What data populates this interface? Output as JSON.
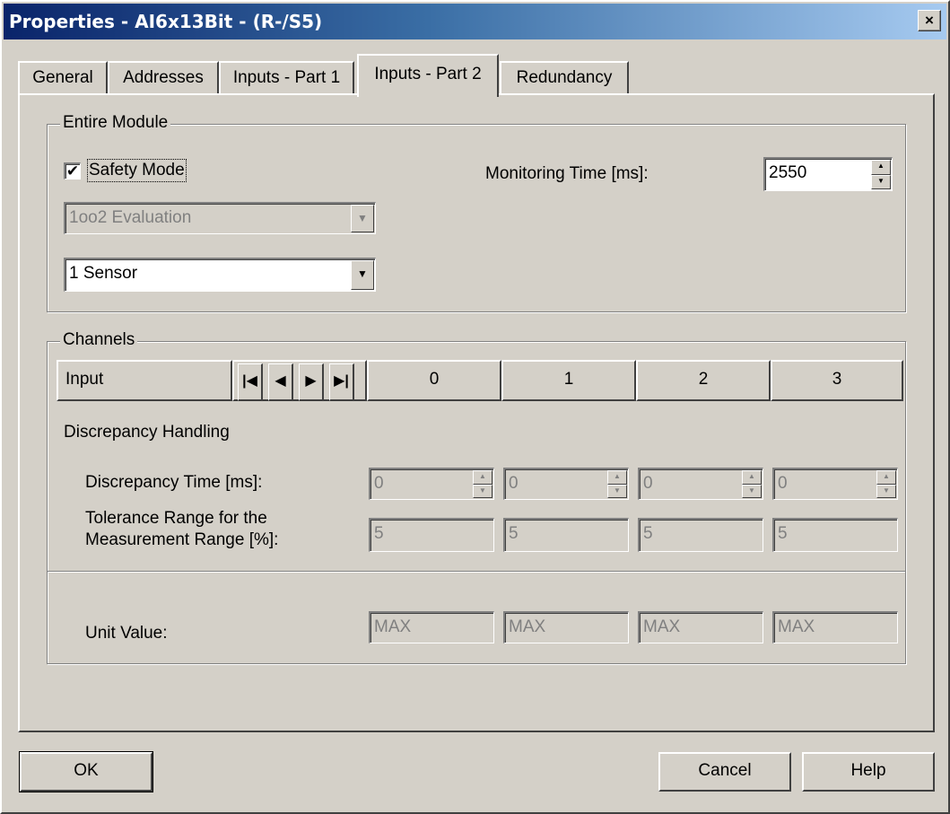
{
  "window": {
    "title": "Properties - AI6x13Bit - (R-/S5)",
    "close_glyph": "×"
  },
  "tabs": [
    "General",
    "Addresses",
    "Inputs - Part 1",
    "Inputs - Part 2",
    "Redundancy"
  ],
  "active_tab": "Inputs - Part 2",
  "entire_module": {
    "label": "Entire Module",
    "safety_mode": {
      "label": "Safety Mode",
      "checked": true,
      "check_glyph": "✔"
    },
    "evaluation_select": {
      "value": "1oo2 Evaluation",
      "disabled": true
    },
    "sensor_select": {
      "value": "1 Sensor",
      "disabled": false
    },
    "monitoring_time": {
      "label": "Monitoring Time [ms]:",
      "value": "2550"
    }
  },
  "channels": {
    "label": "Channels",
    "header_label": "Input",
    "nav_glyphs": [
      "|◀",
      "◀",
      "▶",
      "▶|"
    ],
    "columns": [
      "0",
      "1",
      "2",
      "3"
    ],
    "discrepancy_handling_label": "Discrepancy Handling",
    "discrepancy_time": {
      "label": "Discrepancy Time [ms]:",
      "values": [
        "0",
        "0",
        "0",
        "0"
      ]
    },
    "tolerance_range": {
      "label_line1": "Tolerance Range for the",
      "label_line2": "Measurement Range [%]:",
      "values": [
        "5",
        "5",
        "5",
        "5"
      ]
    },
    "unit_value": {
      "label": "Unit Value:",
      "values": [
        "MAX",
        "MAX",
        "MAX",
        "MAX"
      ]
    }
  },
  "buttons": {
    "ok": "OK",
    "cancel": "Cancel",
    "help": "Help"
  }
}
